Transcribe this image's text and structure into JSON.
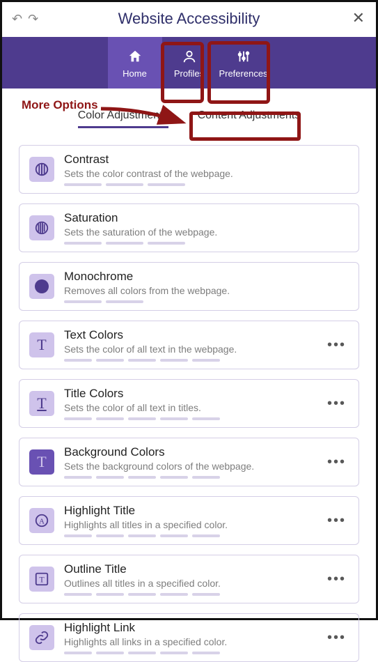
{
  "header": {
    "title": "Website Accessibility"
  },
  "nav": {
    "home": "Home",
    "profiles": "Profiles",
    "preferences": "Preferences"
  },
  "annotation": {
    "label": "More Options"
  },
  "tabs": {
    "color": "Color Adjustments",
    "content": "Content Adjustments"
  },
  "cards": {
    "contrast": {
      "title": "Contrast",
      "desc": "Sets the color contrast of the webpage."
    },
    "saturation": {
      "title": "Saturation",
      "desc": "Sets the saturation of the webpage."
    },
    "monochrome": {
      "title": "Monochrome",
      "desc": "Removes all colors from the webpage."
    },
    "textcolors": {
      "title": "Text Colors",
      "desc": "Sets the color of all text in the webpage."
    },
    "titlecolors": {
      "title": "Title Colors",
      "desc": "Sets the color of all text in titles."
    },
    "bgcolors": {
      "title": "Background Colors",
      "desc": "Sets the background colors of the webpage."
    },
    "hltitle": {
      "title": "Highlight Title",
      "desc": "Highlights all titles in a specified color."
    },
    "outlinetitle": {
      "title": "Outline Title",
      "desc": "Outlines all titles in a specified color."
    },
    "hllink": {
      "title": "Highlight Link",
      "desc": "Highlights all links in a specified color."
    }
  }
}
